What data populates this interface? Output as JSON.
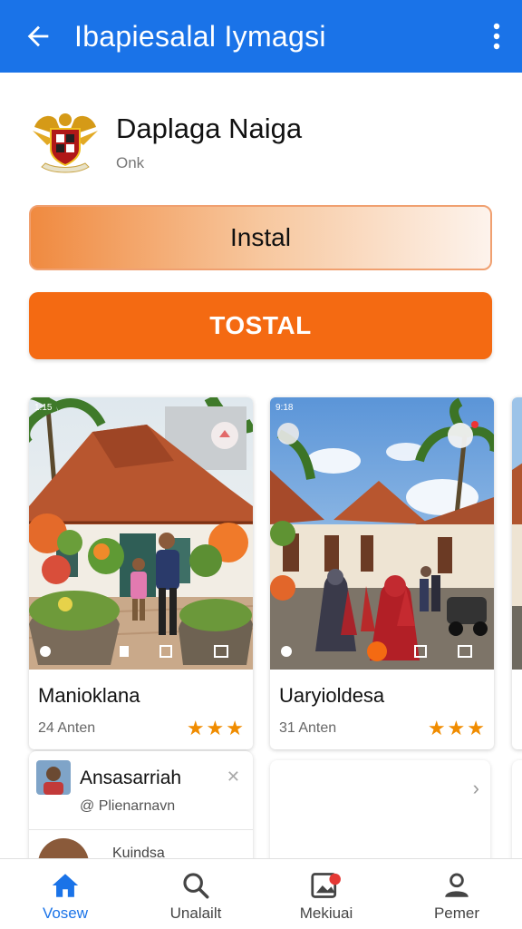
{
  "app_bar": {
    "title": "Ibapiesalal Iymagsi",
    "back_icon": "arrow-back-icon",
    "more_icon": "more-vert-icon",
    "color": "#1a73e8"
  },
  "app": {
    "name": "Daplaga Naiga",
    "subtitle": "Onk",
    "logo_icon": "garuda-emblem-icon"
  },
  "buttons": {
    "install_label": "Instal",
    "primary_label": "TOSTAL",
    "primary_color": "#f46a12"
  },
  "cards": [
    {
      "title": "Manioklana",
      "meta": "24 Anten",
      "rating": 3,
      "stars": "★★★"
    },
    {
      "title": "Uaryioldesa",
      "meta": "31 Anten",
      "rating": 3,
      "stars": "★★★"
    }
  ],
  "list": {
    "items": [
      {
        "title": "Ansasarriah",
        "subtitle": "@ Plienarnavn"
      },
      {
        "title": "Kuindsa"
      }
    ]
  },
  "bottom_nav": [
    {
      "label": "Vosew",
      "icon": "home-icon",
      "active": true
    },
    {
      "label": "Unalailt",
      "icon": "search-icon",
      "active": false
    },
    {
      "label": "Mekiuai",
      "icon": "gallery-notification-icon",
      "active": false
    },
    {
      "label": "Pemer",
      "icon": "person-icon",
      "active": false
    }
  ]
}
